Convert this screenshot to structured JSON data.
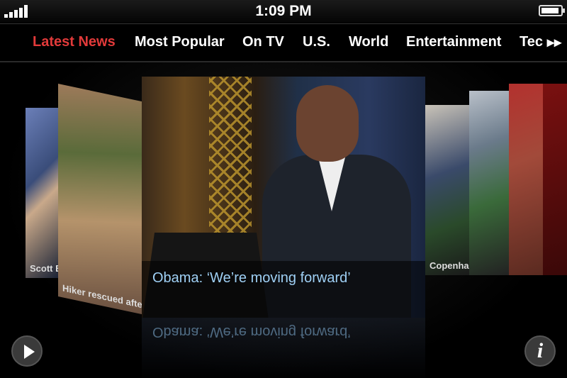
{
  "statusbar": {
    "time": "1:09 PM",
    "signal_icon": "signal-bars-icon",
    "battery_icon": "battery-icon"
  },
  "nav": {
    "items": [
      {
        "label": "Latest News",
        "active": true
      },
      {
        "label": "Most Popular",
        "active": false
      },
      {
        "label": "On TV",
        "active": false
      },
      {
        "label": "U.S.",
        "active": false
      },
      {
        "label": "World",
        "active": false
      },
      {
        "label": "Entertainment",
        "active": false
      },
      {
        "label": "Tec",
        "active": false
      }
    ],
    "more_glyph": "▸▸",
    "active_color": "#e23a3a"
  },
  "carousel": {
    "featured_caption": "Obama: ‘We’re moving forward’",
    "cards": [
      {
        "caption": "Scott B"
      },
      {
        "caption": "Hiker rescued after"
      },
      {
        "caption": "Obama: ‘We’re moving forward’"
      },
      {
        "caption": "Copenhagen deal"
      },
      {
        "caption": ""
      },
      {
        "caption": ""
      }
    ]
  },
  "controls": {
    "play_icon": "play-icon",
    "info_label": "i"
  }
}
